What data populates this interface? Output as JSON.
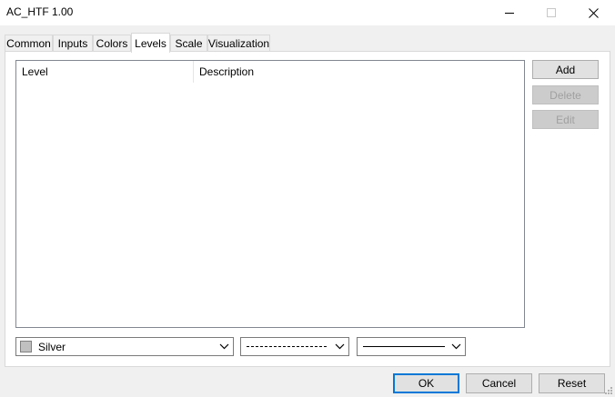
{
  "window": {
    "title": "AC_HTF 1.00"
  },
  "tabs": [
    {
      "label": "Common"
    },
    {
      "label": "Inputs"
    },
    {
      "label": "Colors"
    },
    {
      "label": "Levels",
      "active": true
    },
    {
      "label": "Scale"
    },
    {
      "label": "Visualization"
    }
  ],
  "levels_list": {
    "columns": [
      "Level",
      "Description"
    ],
    "rows": []
  },
  "side_buttons": {
    "add": "Add",
    "delete": "Delete",
    "edit": "Edit"
  },
  "style": {
    "color_name": "Silver",
    "color_hex": "#c0c0c0",
    "line_style": "dash",
    "line_width": "thin"
  },
  "footer": {
    "ok": "OK",
    "cancel": "Cancel",
    "reset": "Reset"
  }
}
